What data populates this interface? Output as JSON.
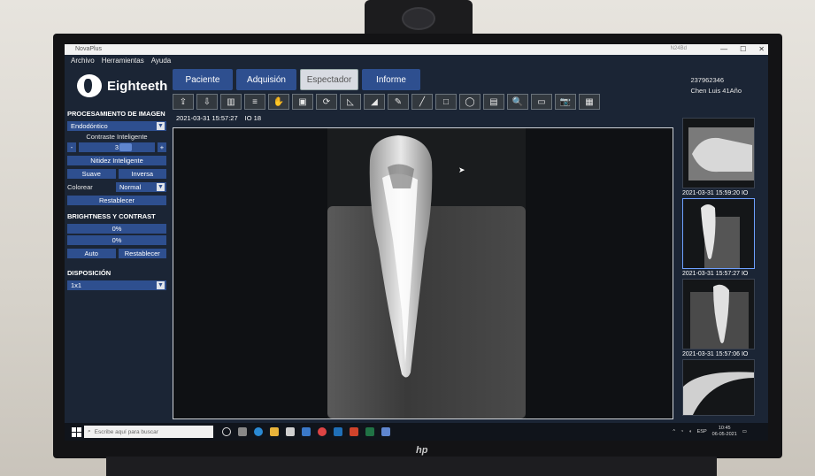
{
  "window": {
    "title": "NovaPlus",
    "right_label": "N24Bd",
    "controls": [
      "—",
      "☐",
      "✕"
    ]
  },
  "menu": [
    "Archivo",
    "Herramientas",
    "Ayuda"
  ],
  "brand": {
    "name": "Eighteeth"
  },
  "tabs": [
    {
      "label": "Paciente",
      "active": false
    },
    {
      "label": "Adquisión",
      "active": false
    },
    {
      "label": "Espectador",
      "active": true
    },
    {
      "label": "Informe",
      "active": false
    }
  ],
  "patient": {
    "id": "237962346",
    "name": "Chen Luis 41Año"
  },
  "toolbar": {
    "icons": [
      "import-icon",
      "export-icon",
      "compare-icon",
      "layers-icon",
      "hand-icon",
      "image-icon",
      "rotate-icon",
      "angle-icon",
      "contrast-icon",
      "pen-icon",
      "line-icon",
      "rectangle-icon",
      "ellipse-icon",
      "text-icon",
      "zoom-icon",
      "note-icon",
      "camera-icon",
      "grid-icon"
    ],
    "glyphs": [
      "⇪",
      "⇩",
      "▥",
      "≡",
      "✋",
      "▣",
      "⟳",
      "◺",
      "◢",
      "✎",
      "╱",
      "□",
      "◯",
      "▤",
      "🔍",
      "▭",
      "📷",
      "▦"
    ]
  },
  "panel": {
    "processing_title": "PROCESAMIENTO DE IMAGEN",
    "mode": "Endodóntico",
    "smart_contrast_label": "Contraste Inteligente",
    "smart_contrast_value": "3",
    "minus": "-",
    "plus": "+",
    "smart_sharpness": "Nitidez Inteligente",
    "smooth": "Suave",
    "inverse": "Inversa",
    "colorize_label": "Colorear",
    "colorize_value": "Normal",
    "reset": "Restablecer",
    "brightness_title": "BRIGHTNESS Y CONTRAST",
    "brightness_value": "0%",
    "contrast_value": "0%",
    "auto": "Auto",
    "reset2": "Restablecer",
    "layout_title": "DISPOSICIÓN",
    "layout_value": "1x1"
  },
  "viewer": {
    "timestamp": "2021-03-31 15:57:27",
    "io": "IO 18"
  },
  "thumbnails": [
    {
      "caption": "2021-03-31 15:59:20  IO"
    },
    {
      "caption": "2021-03-31 15:57:27  IO"
    },
    {
      "caption": "2021-03-31 15:57:06  IO"
    }
  ],
  "taskbar": {
    "search_placeholder": "Escribe aquí para buscar",
    "tray_lang": "ESP",
    "time": "10:45",
    "date": "06-05-2021"
  }
}
